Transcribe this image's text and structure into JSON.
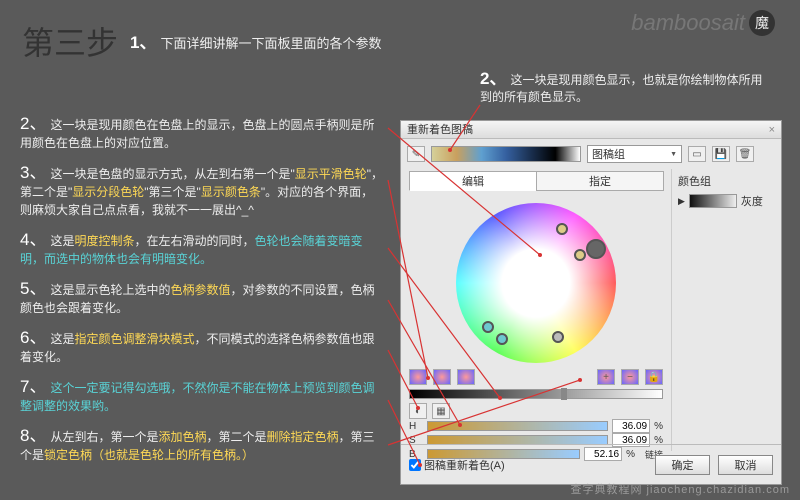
{
  "page": {
    "title": "第三步",
    "brand": "bamboosait"
  },
  "intro": {
    "num": "1、",
    "text": "下面详细讲解一下面板里面的各个参数"
  },
  "note2": {
    "num": "2、",
    "text": "这一块是现用颜色显示，也就是你绘制物体所用到的所有颜色显示。"
  },
  "items": {
    "i2": {
      "num": "2、",
      "a": "这一块是现用颜色在色盘上的显示，色盘上的圆点手柄则是所用颜色在色盘上的对应位置。"
    },
    "i3": {
      "num": "3、",
      "p": "这一块是色盘的显示方式，从左到右第一个是\"",
      "y1": "显示平滑色轮",
      "m": "\"，第二个是\"",
      "y2": "显示分段色轮",
      "q": "\"第三个是\"",
      "y3": "显示颜色条",
      "e": "\"。对应的各个界面，则麻烦大家自己点点看，我就不一一展出^_^"
    },
    "i4": {
      "num": "4、",
      "p": "这是",
      "y1": "明度控制条",
      "m": "，在左右滑动的同时，",
      "c1": "色轮也会随着变暗变明，而选中的物体也会有明暗变化。"
    },
    "i5": {
      "num": "5、",
      "p": "这是显示色轮上选中的",
      "y1": "色柄参数值",
      "e": "，对参数的不同设置，色柄颜色也会跟着变化。"
    },
    "i6": {
      "num": "6、",
      "p": "这是",
      "y1": "指定颜色调整滑块模式",
      "e": "，不同模式的选择色柄参数值也跟着变化。"
    },
    "i7": {
      "num": "7、",
      "c1": "这个一定要记得勾选哦，不然你是不能在物体上预览到颜色调整调整的效果哟。"
    },
    "i8": {
      "num": "8、",
      "p": "从左到右，第一个是",
      "y1": "添加色柄",
      "m": "，第二个是",
      "y2": "删除指定色柄",
      "q": "，第三个是",
      "y3": "锁定色柄（也就是色轮上的所有色柄。）"
    }
  },
  "panel": {
    "title": "重新着色图稿",
    "preset": "图稿组",
    "tab_edit": "编辑",
    "tab_assign": "指定",
    "group_label": "颜色组",
    "swatch_name": "灰度",
    "h": "H",
    "s": "S",
    "b": "B",
    "h_val": "36.09",
    "s_val": "36.09",
    "b_val": "52.16",
    "unit": "%",
    "link": "链接",
    "checkbox": "图稿重新着色(A)",
    "ok": "确定",
    "cancel": "取消"
  },
  "watermark": "查字典教程网 jiaocheng.chazidian.com"
}
